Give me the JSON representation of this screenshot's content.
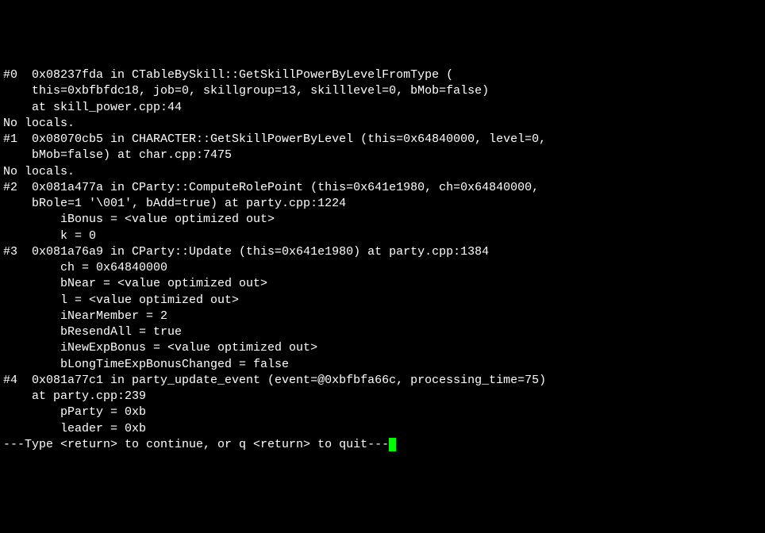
{
  "lines": [
    "#0  0x08237fda in CTableBySkill::GetSkillPowerByLevelFromType (",
    "    this=0xbfbfdc18, job=0, skillgroup=13, skilllevel=0, bMob=false)",
    "    at skill_power.cpp:44",
    "No locals.",
    "#1  0x08070cb5 in CHARACTER::GetSkillPowerByLevel (this=0x64840000, level=0,",
    "    bMob=false) at char.cpp:7475",
    "No locals.",
    "#2  0x081a477a in CParty::ComputeRolePoint (this=0x641e1980, ch=0x64840000,",
    "    bRole=1 '\\001', bAdd=true) at party.cpp:1224",
    "        iBonus = <value optimized out>",
    "        k = 0",
    "#3  0x081a76a9 in CParty::Update (this=0x641e1980) at party.cpp:1384",
    "        ch = 0x64840000",
    "        bNear = <value optimized out>",
    "        l = <value optimized out>",
    "        iNearMember = 2",
    "        bResendAll = true",
    "        iNewExpBonus = <value optimized out>",
    "        bLongTimeExpBonusChanged = false",
    "#4  0x081a77c1 in party_update_event (event=@0xbfbfa66c, processing_time=75)",
    "    at party.cpp:239",
    "        pParty = 0xb",
    "        leader = 0xb"
  ],
  "prompt": "---Type <return> to continue, or q <return> to quit---"
}
